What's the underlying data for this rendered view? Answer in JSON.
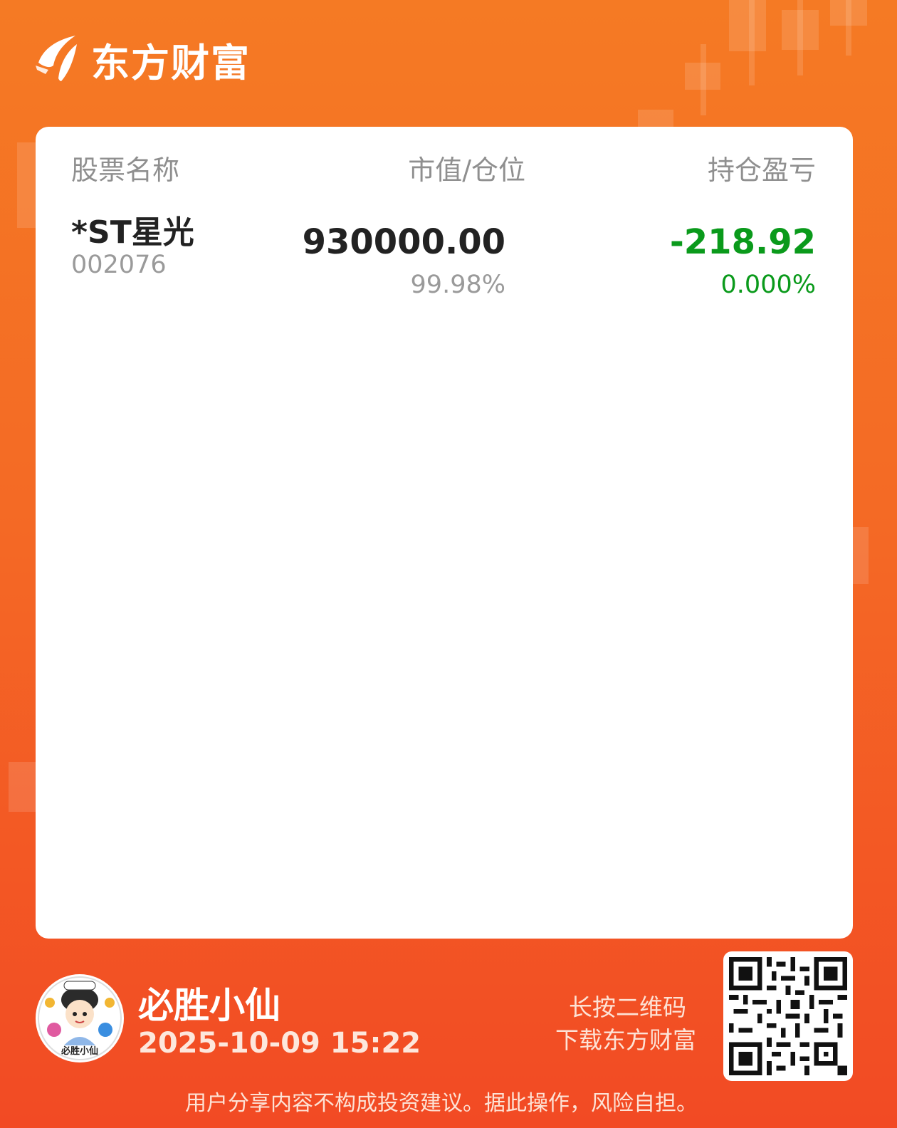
{
  "brand": {
    "name": "东方财富",
    "logo_icon": "eastmoney-logo-icon"
  },
  "table": {
    "headers": {
      "name": "股票名称",
      "value": "市值/仓位",
      "pl": "持仓盈亏"
    },
    "rows": [
      {
        "name": "*ST星光",
        "code": "002076",
        "market_value": "930000.00",
        "position": "99.98%",
        "pl_amount": "-218.92",
        "pl_percent": "0.000%"
      }
    ]
  },
  "user": {
    "name": "必胜小仙",
    "share_time": "2025-10-09 15:22",
    "avatar_text": "必胜小仙"
  },
  "qr": {
    "tip_line1": "长按二维码",
    "tip_line2": "下载东方财富",
    "icon": "qr-code-icon"
  },
  "disclaimer": "用户分享内容不构成投资建议。据此操作，风险自担。",
  "colors": {
    "background_top": "#f57a24",
    "background_bottom": "#f24a24",
    "loss_green": "#0a9a1b"
  }
}
